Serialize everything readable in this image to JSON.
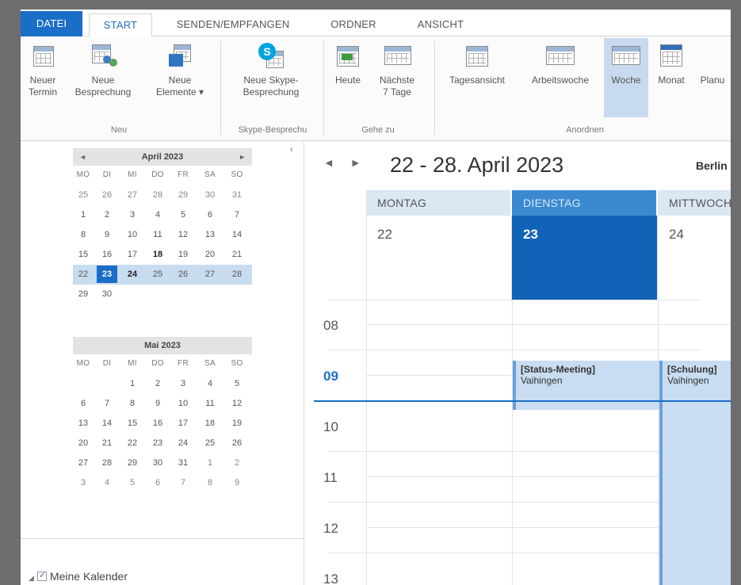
{
  "tabs": {
    "file": "DATEI",
    "start": "START",
    "send_receive": "SENDEN/EMPFANGEN",
    "folder": "ORDNER",
    "view": "ANSICHT"
  },
  "ribbon": {
    "new_appointment": "Neuer\nTermin",
    "new_meeting": "Neue\nBesprechung",
    "new_items": "Neue\nElemente ▾",
    "new_skype_meeting": "Neue Skype-\nBesprechung",
    "today": "Heute",
    "next_7_days": "Nächste\n7 Tage",
    "day_view": "Tagesansicht",
    "work_week": "Arbeitswoche",
    "week": "Woche",
    "month": "Monat",
    "schedule": "Planu",
    "group_new": "Neu",
    "group_skype": "Skype-Besprechu",
    "group_goto": "Gehe zu",
    "group_arrange": "Anordnen"
  },
  "mini_april": {
    "title": "April 2023",
    "weekdays": [
      "MO",
      "DI",
      "MI",
      "DO",
      "FR",
      "SA",
      "SO"
    ],
    "weeks": [
      [
        "25",
        "26",
        "27",
        "28",
        "29",
        "30",
        "31"
      ],
      [
        "1",
        "2",
        "3",
        "4",
        "5",
        "6",
        "7"
      ],
      [
        "8",
        "9",
        "10",
        "11",
        "12",
        "13",
        "14"
      ],
      [
        "15",
        "16",
        "17",
        "18",
        "19",
        "20",
        "21"
      ],
      [
        "22",
        "23",
        "24",
        "25",
        "26",
        "27",
        "28"
      ],
      [
        "29",
        "30",
        "",
        "",
        "",
        "",
        ""
      ]
    ]
  },
  "mini_may": {
    "title": "Mai 2023",
    "weekdays": [
      "MO",
      "DI",
      "MI",
      "DO",
      "FR",
      "SA",
      "SO"
    ],
    "weeks": [
      [
        "",
        "",
        "1",
        "2",
        "3",
        "4",
        "5"
      ],
      [
        "6",
        "7",
        "8",
        "9",
        "10",
        "11",
        "12"
      ],
      [
        "13",
        "14",
        "15",
        "16",
        "17",
        "18",
        "19"
      ],
      [
        "20",
        "21",
        "22",
        "23",
        "24",
        "25",
        "26"
      ],
      [
        "27",
        "28",
        "29",
        "30",
        "31",
        "1",
        "2"
      ],
      [
        "3",
        "4",
        "5",
        "6",
        "7",
        "8",
        "9"
      ]
    ]
  },
  "my_calendars": "Meine Kalender",
  "calendar": {
    "title": "22 - 28. April 2023",
    "location": "Berlin",
    "days": [
      {
        "name": "MONTAG",
        "num": "22"
      },
      {
        "name": "DIENSTAG",
        "num": "23"
      },
      {
        "name": "MITTWOCH",
        "num": "24"
      }
    ],
    "hours": [
      "08",
      "09",
      "10",
      "11",
      "12",
      "13"
    ],
    "events": [
      {
        "subject": "[Status-Meeting]",
        "location": "Vaihingen"
      },
      {
        "subject": "[Schulung]",
        "location": "Vaihingen"
      }
    ]
  },
  "colors": {
    "accent": "#1a6ec7",
    "today_fill": "#1063b6",
    "event_fill": "#c9ddf2"
  }
}
